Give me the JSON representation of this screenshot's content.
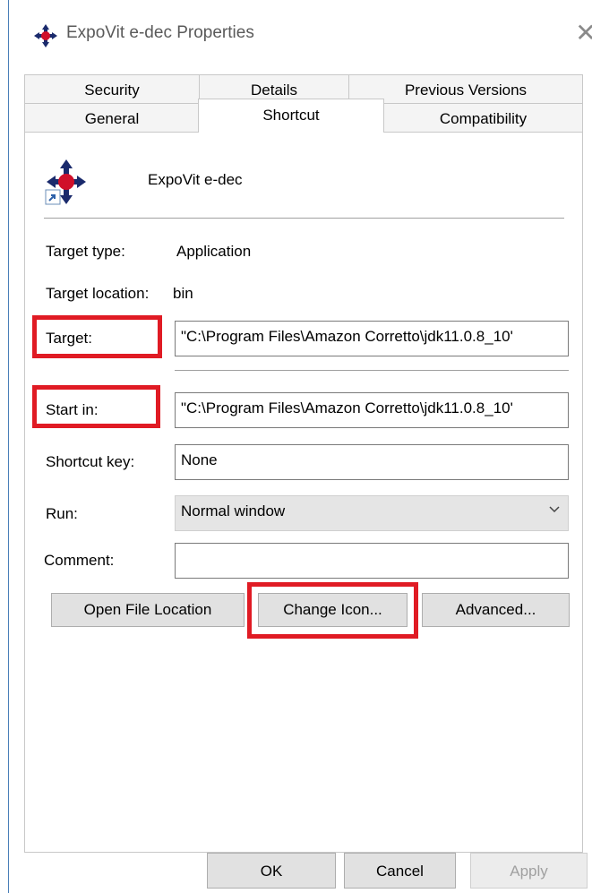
{
  "window": {
    "title": "ExpoVit e-dec Properties",
    "close_glyph": "✕"
  },
  "tabs": {
    "row1": [
      "Security",
      "Details",
      "Previous Versions"
    ],
    "row2": [
      "General",
      "Shortcut",
      "Compatibility"
    ],
    "active": "Shortcut"
  },
  "shortcut": {
    "name": "ExpoVit e-dec",
    "target_type_label": "Target type:",
    "target_type_value": "Application",
    "target_location_label": "Target location:",
    "target_location_value": "bin",
    "target_label": "Target:",
    "target_value": "\"C:\\Program Files\\Amazon Corretto\\jdk11.0.8_10'",
    "start_in_label": "Start in:",
    "start_in_value": "\"C:\\Program Files\\Amazon Corretto\\jdk11.0.8_10'",
    "shortcut_key_label": "Shortcut key:",
    "shortcut_key_value": "None",
    "run_label": "Run:",
    "run_value": "Normal window",
    "comment_label": "Comment:",
    "comment_value": ""
  },
  "buttons": {
    "open_file_location": "Open File Location",
    "change_icon": "Change Icon...",
    "advanced": "Advanced...",
    "ok": "OK",
    "cancel": "Cancel",
    "apply": "Apply"
  },
  "colors": {
    "highlight": "#e01b24",
    "icon_navy": "#1a2a6c",
    "icon_red": "#d0102a"
  },
  "icons": [
    "app-icon",
    "shortcut-arrow-icon",
    "close-icon",
    "chevron-down-icon"
  ]
}
